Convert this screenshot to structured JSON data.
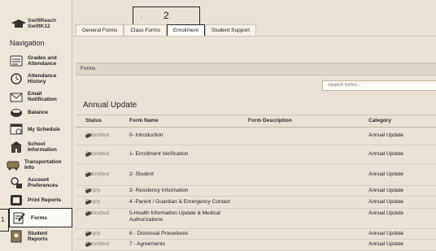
{
  "sidebar": {
    "logo_line1": "SwiftReach",
    "logo_line2": "SwiftK12",
    "nav_title": "Navigation",
    "items": [
      {
        "label_line1": "Grades and",
        "label_line2": "Attendance"
      },
      {
        "label_line1": "Attendance",
        "label_line2": "History"
      },
      {
        "label_line1": "Email",
        "label_line2": "Notification"
      },
      {
        "label_line1": "Balance",
        "label_line2": ""
      },
      {
        "label_line1": "My Schedule",
        "label_line2": ""
      },
      {
        "label_line1": "School",
        "label_line2": "Information"
      },
      {
        "label_line1": "Transportation",
        "label_line2": "Info"
      },
      {
        "label_line1": "Account",
        "label_line2": "Preferences"
      },
      {
        "label_line1": "Print Reports",
        "label_line2": ""
      },
      {
        "label_line1": "Forms",
        "label_line2": ""
      },
      {
        "label_line1": "Student",
        "label_line2": "Reports"
      }
    ],
    "marker": "1"
  },
  "tabs": [
    {
      "label": "General Forms"
    },
    {
      "label": "Class Forms"
    },
    {
      "label": "Enrollment"
    },
    {
      "label": "Student Support"
    }
  ],
  "tab_marker": "2",
  "tab_tick": "-",
  "forms_bar": "Forms",
  "search_placeholder": "Search forms...",
  "section_title": "Annual Update",
  "columns": {
    "status": "Status",
    "name": "Form Name",
    "desc": "Form Description",
    "cat": "Category"
  },
  "rows": [
    {
      "status": "Submitted",
      "name": "0- Introduction",
      "name2": "",
      "desc": "",
      "cat": "Annual Update"
    },
    {
      "status": "Submitted",
      "name": "1- Enrollment Verification",
      "name2": "",
      "desc": "",
      "cat": "Annual Update"
    },
    {
      "status": "Submitted",
      "name": "2- Student",
      "name2": "",
      "desc": "",
      "cat": "Annual Update"
    },
    {
      "status": "Empty",
      "name": "3- Residency Information",
      "name2": "",
      "desc": "",
      "cat": "Annual Update"
    },
    {
      "status": "Empty",
      "name": "4 -Parent / Guardian & Emergency Contact",
      "name2": "",
      "desc": "",
      "cat": "Annual Update"
    },
    {
      "status": "Submitted",
      "name": "5-Health Information Update & Medical",
      "name2": "Authorizations",
      "desc": "",
      "cat": "Annual Update"
    },
    {
      "status": "Empty",
      "name": "6 - Dismissal Procedures",
      "name2": "",
      "desc": "",
      "cat": "Annual Update"
    },
    {
      "status": "Submitted",
      "name": "7 - Agreements",
      "name2": "",
      "desc": "",
      "cat": "Annual Update"
    }
  ],
  "colors": {
    "background": "#e9e3d5",
    "border": "#cfc6b3",
    "highlight_box": "#222222"
  }
}
